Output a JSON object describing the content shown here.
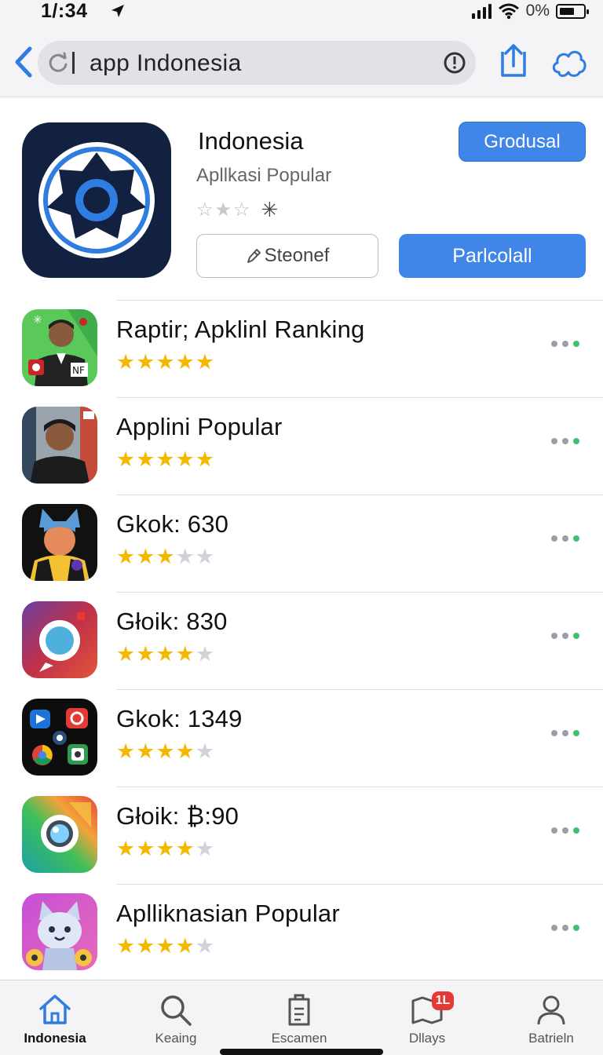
{
  "status_bar": {
    "time": "1/:34",
    "battery_text": "0%"
  },
  "search": {
    "query": "app Indonesia"
  },
  "featured": {
    "title": "Indonesia",
    "subtitle": "Apllkasi Popular",
    "rating_stars": 3,
    "primary_small_label": "Grodusal",
    "outline_label": "Steonef",
    "primary_label": "Parlcolall"
  },
  "apps": [
    {
      "title": "Raptir; Apklinl Ranking",
      "rating": 5,
      "icon": "person-portrait-icon"
    },
    {
      "title": "Applini Popular",
      "rating": 5,
      "icon": "person-portrait-icon"
    },
    {
      "title": "Gkok: 630",
      "rating": 3,
      "icon": "cat-avatar-icon"
    },
    {
      "title": "Głoik: 830",
      "rating": 4,
      "icon": "camera-lens-icon"
    },
    {
      "title": "Gkok: 1349",
      "rating": 4,
      "icon": "app-folder-icon"
    },
    {
      "title": "Głoik: ₿:90",
      "rating": 4,
      "icon": "camera-lens-icon"
    },
    {
      "title": "Aplliknasian Popular",
      "rating": 4,
      "icon": "cat-mascot-icon"
    }
  ],
  "tabs": [
    {
      "label": "Indonesia",
      "icon": "home-icon",
      "active": true
    },
    {
      "label": "Keaing",
      "icon": "search-icon",
      "active": false
    },
    {
      "label": "Escamen",
      "icon": "document-icon",
      "active": false
    },
    {
      "label": "Dllays",
      "icon": "map-icon",
      "active": false,
      "badge": "1L"
    },
    {
      "label": "Batrieln",
      "icon": "person-icon",
      "active": false
    }
  ],
  "colors": {
    "accent": "#3f86e8",
    "star": "#f5b800",
    "more_dot": "#3cc36b"
  }
}
